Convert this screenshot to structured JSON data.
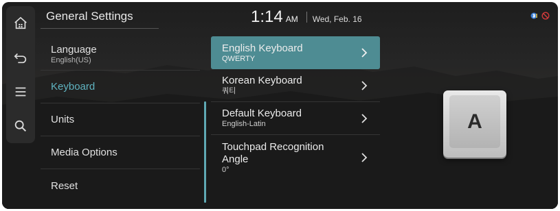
{
  "header": {
    "title": "General Settings",
    "time": "1:14",
    "ampm": "AM",
    "date": "Wed, Feb. 16"
  },
  "rail": {
    "icons": [
      "home-icon",
      "back-icon",
      "menu-icon",
      "search-icon"
    ]
  },
  "status_icons": [
    "bluetooth-phone-icon",
    "mic-mute-icon"
  ],
  "menu": {
    "items": [
      {
        "label": "Language",
        "sub": "English(US)",
        "active": false
      },
      {
        "label": "Keyboard",
        "sub": "",
        "active": true
      },
      {
        "label": "Units",
        "sub": "",
        "active": false
      },
      {
        "label": "Media Options",
        "sub": "",
        "active": false
      },
      {
        "label": "Reset",
        "sub": "",
        "active": false
      }
    ]
  },
  "submenu": {
    "items": [
      {
        "label": "English Keyboard",
        "value": "QWERTY",
        "selected": true
      },
      {
        "label": "Korean Keyboard",
        "value": "쿼티",
        "selected": false
      },
      {
        "label": "Default Keyboard",
        "value": "English-Latin",
        "selected": false
      },
      {
        "label": "Touchpad Recognition Angle",
        "label_line1": "Touchpad Recognition",
        "label_line2": "Angle",
        "value": "0°",
        "selected": false
      }
    ]
  },
  "preview": {
    "key_letter": "A"
  },
  "colors": {
    "accent": "#5fb3c0",
    "selected_bg": "#4e8c93",
    "background": "#1c1c1c"
  }
}
